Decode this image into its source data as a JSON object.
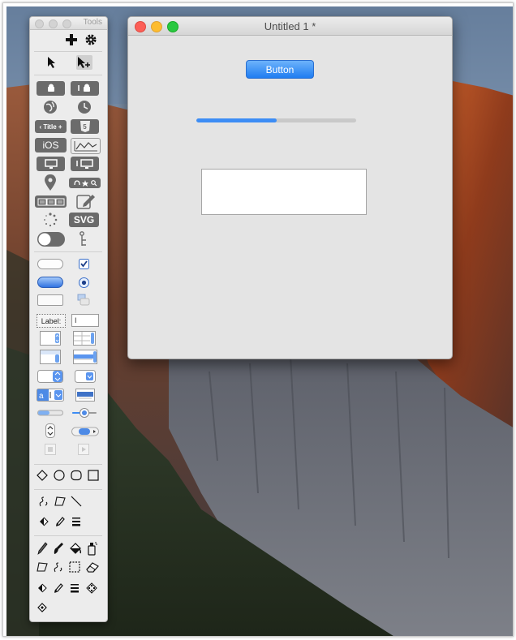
{
  "tools_window": {
    "title": "Tools",
    "title_label_widget": "Title",
    "ios_label": "iOS",
    "svg_label": "SVG",
    "label_widget": "Label:",
    "html5_label": "5",
    "textfield_cursor": "I"
  },
  "main_window": {
    "title": "Untitled 1 *",
    "button_label": "Button",
    "progress_fraction": 0.5
  },
  "colors": {
    "accent": "#1f7cf1",
    "close": "#fc5f57",
    "minimize": "#fdbc2e",
    "zoom": "#29c840"
  }
}
